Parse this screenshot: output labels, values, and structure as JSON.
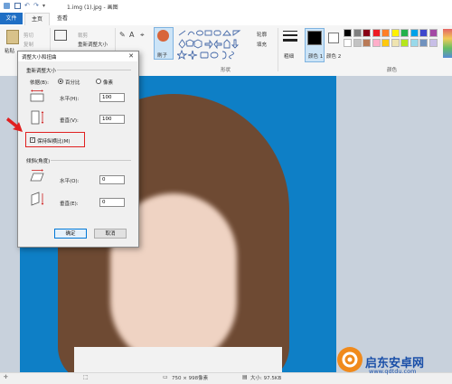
{
  "window": {
    "title": "1.img (1).jpg - 画图"
  },
  "tabs": [
    {
      "label": "文件"
    },
    {
      "label": "主页"
    },
    {
      "label": "查看"
    }
  ],
  "ribbon": {
    "clipboard": {
      "paste": "粘贴",
      "cut": "剪切",
      "copy": "复制"
    },
    "image": {
      "crop": "裁剪",
      "resize": "重新调整大小"
    },
    "brushes": "刷子",
    "shapes": {
      "outline": "轮廓",
      "fill": "填充",
      "group_label": "形状"
    },
    "size_label": "粗细",
    "color1_label": "颜色 1",
    "color2_label": "颜色 2",
    "colors_group_label": "颜色",
    "color1": "#000000",
    "color2": "#ffffff",
    "palette": [
      "#000000",
      "#7f7f7f",
      "#880015",
      "#ed1c24",
      "#ff7f27",
      "#fff200",
      "#22b14c",
      "#00a2e8",
      "#3f48cc",
      "#a349a4",
      "#ffffff",
      "#c3c3c3",
      "#b97a57",
      "#ffaec9",
      "#ffc90e",
      "#efe4b0",
      "#b5e61d",
      "#99d9ea",
      "#7092be",
      "#c8bfe7"
    ]
  },
  "dialog": {
    "title": "调整大小和扭曲",
    "resize_section": "重新调整大小",
    "by_label": "依据(B):",
    "percent_option": "百分比",
    "pixels_option": "像素",
    "horizontal_label": "水平(H):",
    "horizontal_value": "100",
    "vertical_label": "垂直(V):",
    "vertical_value": "100",
    "keep_ratio_label": "保持纵横比(M)",
    "skew_section": "倾斜(角度)",
    "skew_horizontal_label": "水平(O):",
    "skew_horizontal_value": "0",
    "skew_vertical_label": "垂直(E):",
    "skew_vertical_value": "0",
    "ok_label": "确定",
    "cancel_label": "取消"
  },
  "statusbar": {
    "dimensions": "750 × 998像素",
    "filesize": "大小: 97.5KB"
  },
  "watermark": {
    "brand": "启东安卓网",
    "url": "www.qdtdu.com"
  }
}
